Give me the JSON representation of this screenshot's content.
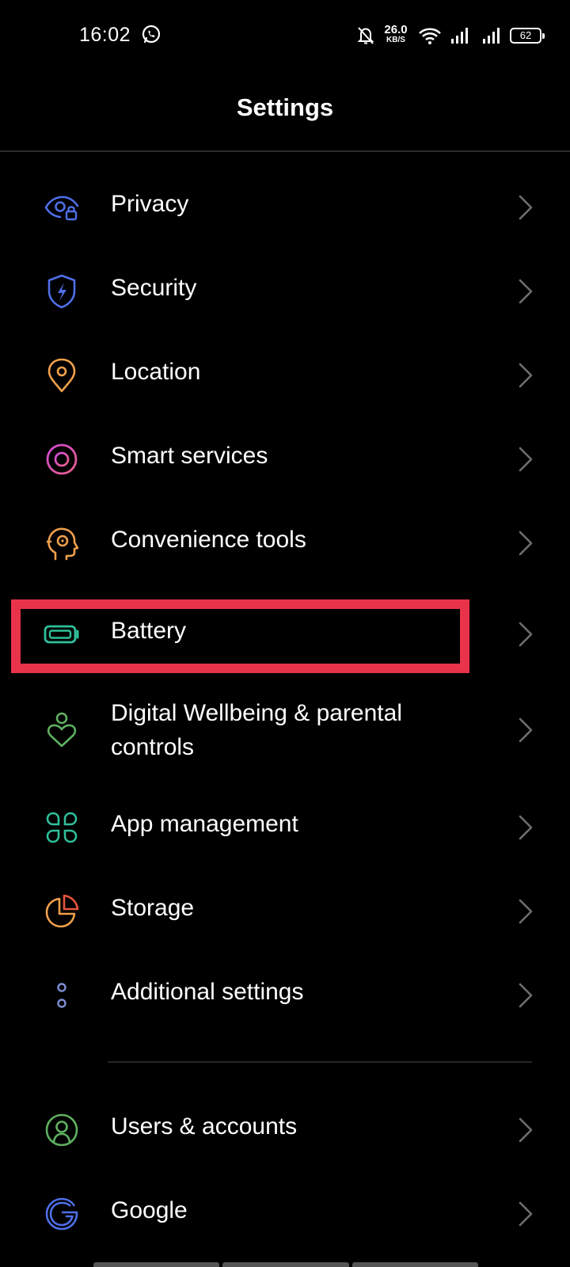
{
  "status_bar": {
    "time": "16:02",
    "net_speed_value": "26.0",
    "net_speed_unit": "KB/S",
    "battery_level": "62",
    "icons": [
      "whatsapp-icon",
      "mute-icon",
      "wifi-icon",
      "signal-icon",
      "signal-icon",
      "battery-icon"
    ]
  },
  "header": {
    "title": "Settings"
  },
  "items": [
    {
      "label": "Privacy",
      "icon": "privacy-eye-lock-icon",
      "color": "#4f6fe8"
    },
    {
      "label": "Security",
      "icon": "shield-bolt-icon",
      "color": "#4f6fe8"
    },
    {
      "label": "Location",
      "icon": "location-pin-icon",
      "color": "#f0a04b"
    },
    {
      "label": "Smart services",
      "icon": "smart-services-ring-icon",
      "color": "#c24dd6"
    },
    {
      "label": "Convenience tools",
      "icon": "convenience-tools-head-icon",
      "color": "#f0a04b"
    },
    {
      "label": "Battery",
      "icon": "battery-icon",
      "color": "#2fbf9b"
    },
    {
      "label": "Digital Wellbeing & parental controls",
      "label_line1": "Digital Wellbeing & parental",
      "label_line2": "controls",
      "icon": "wellbeing-heart-icon",
      "color": "#5fb060"
    },
    {
      "label": "App management",
      "icon": "app-grid-icon",
      "color": "#2fbf9b"
    },
    {
      "label": "Storage",
      "icon": "storage-pie-icon",
      "color": "#f0a04b"
    },
    {
      "label": "Additional settings",
      "icon": "additional-dots-icon",
      "color": "#7f8fd6"
    },
    {
      "label": "Users & accounts",
      "icon": "user-account-icon",
      "color": "#5fb060"
    },
    {
      "label": "Google",
      "icon": "google-g-icon",
      "color": "#4f6fe8"
    }
  ],
  "highlight": {
    "target": "Battery",
    "color": "#e8334a"
  }
}
